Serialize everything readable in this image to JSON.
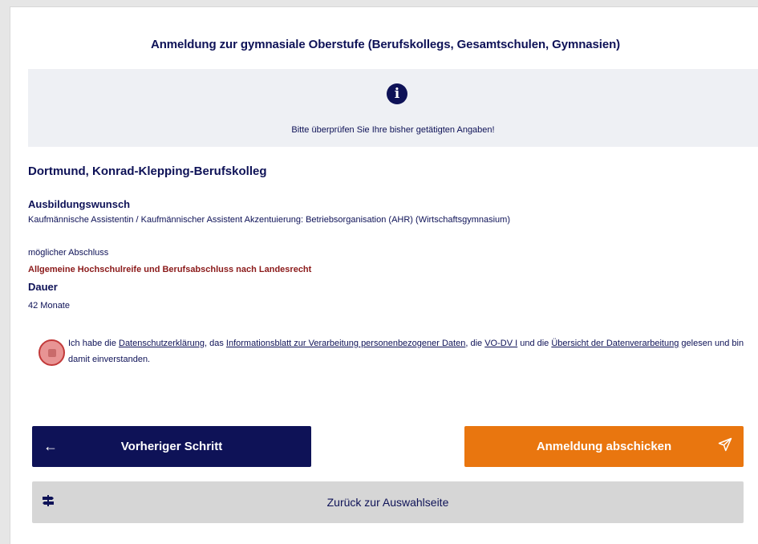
{
  "header": {
    "title": "Anmeldung zur gymnasiale Oberstufe (Berufskollegs, Gesamtschulen, Gymnasien)"
  },
  "info": {
    "icon": "info-icon",
    "text": "Bitte überprüfen Sie Ihre bisher getätigten Angaben!"
  },
  "school": {
    "name": "Dortmund, Konrad-Klepping-Berufskolleg"
  },
  "details": {
    "ausbildung_label": "Ausbildungswunsch",
    "ausbildung_value": "Kaufmännische Assistentin / Kaufmännischer Assistent Akzentuierung: Betriebsorganisation (AHR) (Wirtschaftsgymnasium)",
    "abschluss_label": "möglicher Abschluss",
    "abschluss_value": "Allgemeine Hochschulreife und Berufsabschluss nach Landesrecht",
    "dauer_label": "Dauer",
    "dauer_value": "42 Monate"
  },
  "consent": {
    "checked": true,
    "part1": "Ich habe die ",
    "link1": "Datenschutzerklärung",
    "part2": ", das ",
    "link2": "Informationsblatt zur Verarbeitung personenbezogener Daten",
    "part3": ", die ",
    "link3": "VO-DV I",
    "part4": " und die ",
    "link4": "Übersicht der Datenverarbeitung",
    "part5": " gelesen und bin damit einverstanden."
  },
  "buttons": {
    "prev_label": "Vorheriger Schritt",
    "prev_icon": "arrow-left-icon",
    "send_label": "Anmeldung abschicken",
    "send_icon": "paper-plane-icon",
    "back_label": "Zurück zur Auswahlseite",
    "back_icon": "signpost-icon"
  },
  "colors": {
    "primary": "#0e1257",
    "accent": "#e9760f",
    "secondary": "#d6d6d6",
    "info_bg": "#eef0f4",
    "highlight_red": "#8b1a1a"
  }
}
